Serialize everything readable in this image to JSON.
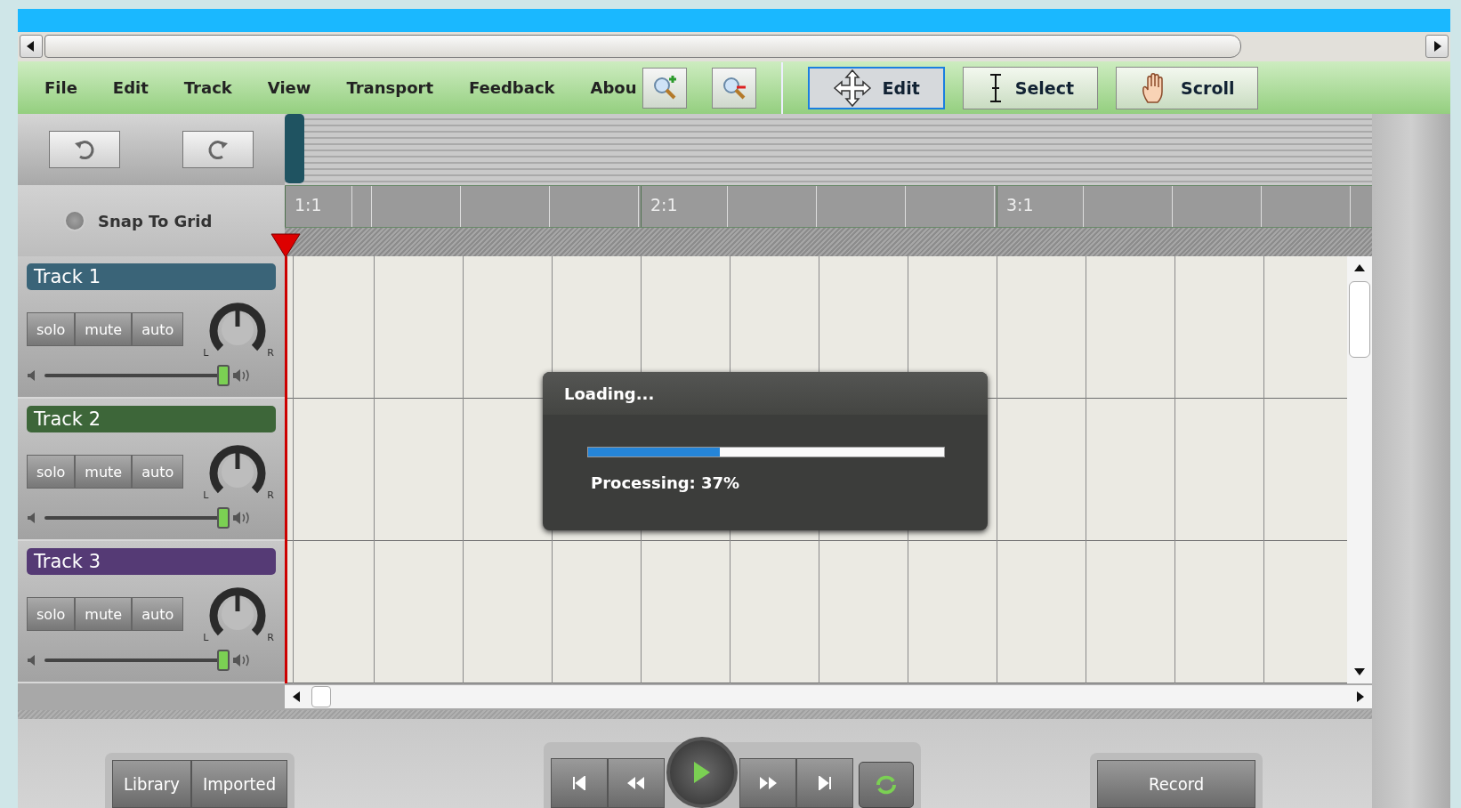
{
  "menu": [
    "File",
    "Edit",
    "Track",
    "View",
    "Transport",
    "Feedback",
    "Abou"
  ],
  "tools": [
    {
      "label": "Edit",
      "kind": "move",
      "selected": true
    },
    {
      "label": "Select",
      "kind": "text",
      "selected": false
    },
    {
      "label": "Scroll",
      "kind": "hand",
      "selected": false
    }
  ],
  "snap": {
    "label": "Snap To Grid",
    "checked": false
  },
  "ruler": [
    "1:1",
    "2:1",
    "3:1"
  ],
  "tracks": [
    {
      "name": "Track 1",
      "color": "#3a6478",
      "buttons": [
        "solo",
        "mute",
        "auto"
      ],
      "pan_labels": [
        "L",
        "R"
      ],
      "level": 0.98
    },
    {
      "name": "Track 2",
      "color": "#3d6639",
      "buttons": [
        "solo",
        "mute",
        "auto"
      ],
      "pan_labels": [
        "L",
        "R"
      ],
      "level": 0.98
    },
    {
      "name": "Track 3",
      "color": "#553a75",
      "buttons": [
        "solo",
        "mute",
        "auto"
      ],
      "pan_labels": [
        "L",
        "R"
      ],
      "level": 0.98
    }
  ],
  "dialog": {
    "title": "Loading...",
    "level": 0.37,
    "status": "Processing: 37%"
  },
  "library": [
    {
      "label": "Library"
    },
    {
      "label": "Imported"
    }
  ],
  "record": "Record"
}
